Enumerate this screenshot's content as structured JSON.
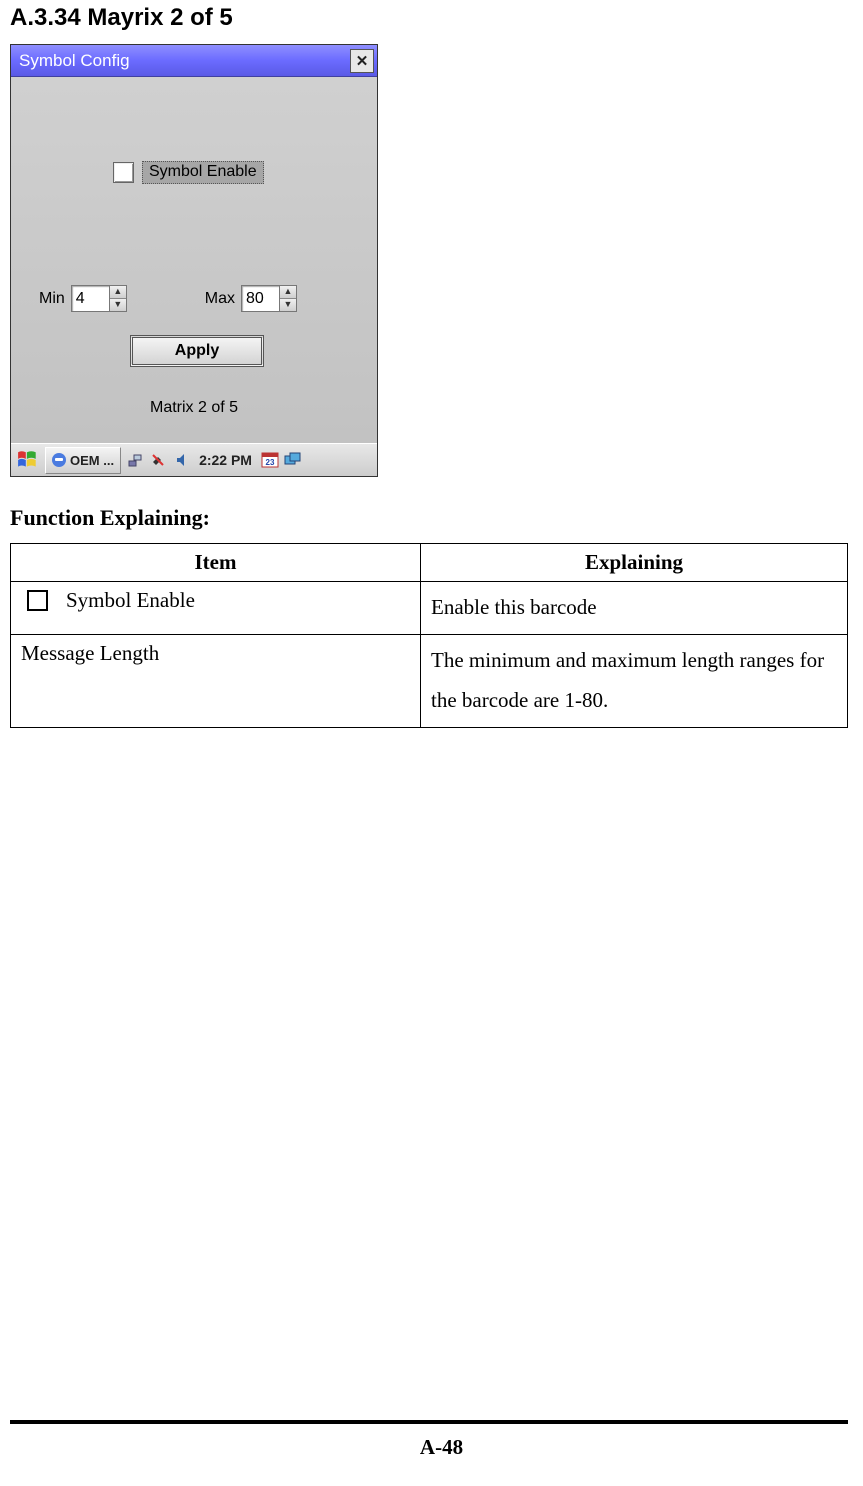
{
  "heading": "A.3.34 Mayrix 2 of 5",
  "window": {
    "title": "Symbol Config",
    "checkbox_label": "Symbol Enable",
    "min_label": "Min",
    "min_value": "4",
    "max_label": "Max",
    "max_value": "80",
    "apply_label": "Apply",
    "footer": "Matrix 2 of 5"
  },
  "taskbar": {
    "app_button": "OEM ...",
    "clock": "2:22 PM"
  },
  "function": {
    "heading": "Function Explaining:",
    "col_item": "Item",
    "col_explain": "Explaining",
    "rows": [
      {
        "item": "Symbol Enable",
        "explain": "Enable this barcode",
        "has_checkbox": true
      },
      {
        "item": "Message Length",
        "explain": "The minimum and maximum length ranges for the barcode are 1-80."
      }
    ]
  },
  "page_number": "A-48"
}
